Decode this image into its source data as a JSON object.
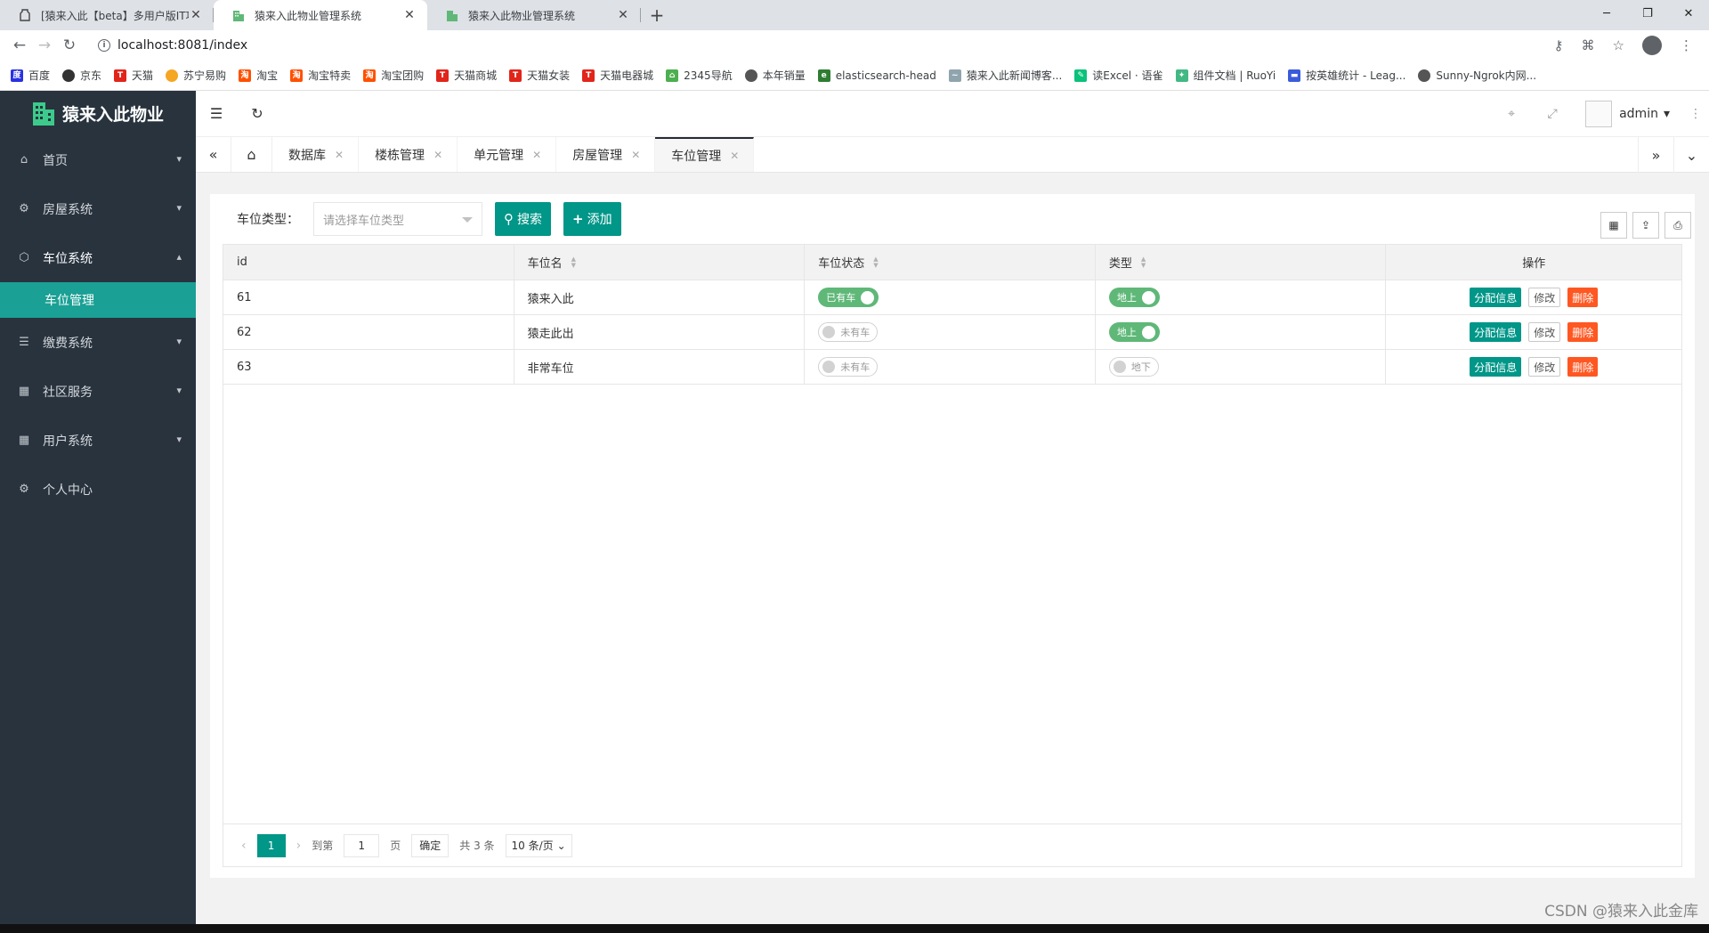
{
  "browser": {
    "tabs": [
      {
        "title": "[猿来入此【beta】多用户版IT项",
        "active": false
      },
      {
        "title": "猿来入此物业管理系统",
        "active": true
      },
      {
        "title": "猿来入此物业管理系统",
        "active": false
      }
    ],
    "url": "localhost:8081/index",
    "bookmarks": [
      "百度",
      "京东",
      "天猫",
      "苏宁易购",
      "淘宝",
      "淘宝特卖",
      "淘宝团购",
      "天猫商城",
      "天猫女装",
      "天猫电器城",
      "2345导航",
      "本年销量",
      "elasticsearch-head",
      "猿来入此新闻博客...",
      "读Excel · 语雀",
      "组件文档 | RuoYi",
      "按英雄统计 - Leag...",
      "Sunny-Ngrok内网..."
    ]
  },
  "app": {
    "title": "猿来入此物业",
    "user": "admin",
    "menu": [
      {
        "label": "首页",
        "icon": "home-icon"
      },
      {
        "label": "房屋系统",
        "icon": "gear-icon"
      },
      {
        "label": "车位系统",
        "icon": "cube-icon"
      },
      {
        "label": "缴费系统",
        "icon": "list-icon"
      },
      {
        "label": "社区服务",
        "icon": "grid-icon"
      },
      {
        "label": "用户系统",
        "icon": "grid-icon"
      },
      {
        "label": "个人中心",
        "icon": "gear-icon"
      }
    ],
    "submenu_active": "车位管理",
    "pagetabs": [
      "数据库",
      "楼栋管理",
      "单元管理",
      "房屋管理",
      "车位管理"
    ]
  },
  "filter": {
    "label": "车位类型：",
    "placeholder": "请选择车位类型",
    "search": "搜索",
    "add": "添加"
  },
  "table": {
    "headers": [
      "id",
      "车位名",
      "车位状态",
      "类型",
      "操作"
    ],
    "rows": [
      {
        "id": "61",
        "name": "猿来入此",
        "status": "已有车",
        "status_on": true,
        "type": "地上",
        "type_on": true
      },
      {
        "id": "62",
        "name": "猿走此出",
        "status": "未有车",
        "status_on": false,
        "type": "地上",
        "type_on": true
      },
      {
        "id": "63",
        "name": "非常车位",
        "status": "未有车",
        "status_on": false,
        "type": "地下",
        "type_on": false
      }
    ],
    "ops": {
      "assign": "分配信息",
      "edit": "修改",
      "delete": "删除"
    }
  },
  "pager": {
    "current": "1",
    "goto": "到第",
    "page_input": "1",
    "page_unit": "页",
    "confirm": "确定",
    "total": "共 3 条",
    "limit": "10 条/页"
  },
  "watermark": "CSDN @猿来入此金库",
  "colors": {
    "sidebar": "#28333e",
    "accent": "#009688",
    "active_menu": "#1aa094",
    "danger": "#ff5722",
    "switch_on": "#5fb878"
  }
}
